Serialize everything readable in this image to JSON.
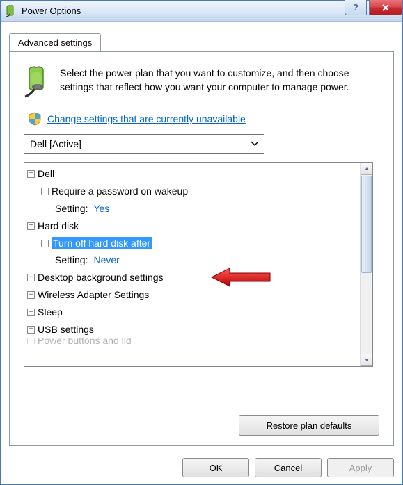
{
  "window": {
    "title": "Power Options"
  },
  "tabs": {
    "advanced": "Advanced settings"
  },
  "intro": {
    "text": "Select the power plan that you want to customize, and then choose settings that reflect how you want your computer to manage power."
  },
  "shield": {
    "link_text": "Change settings that are currently unavailable"
  },
  "combo": {
    "selected": "Dell [Active]"
  },
  "tree": {
    "root": "Dell",
    "password": {
      "label": "Require a password on wakeup",
      "setting_label": "Setting:",
      "setting_value": "Yes"
    },
    "harddisk": {
      "label": "Hard disk",
      "turnoff": {
        "label": "Turn off hard disk after",
        "setting_label": "Setting:",
        "setting_value": "Never"
      }
    },
    "desktop_bg": "Desktop background settings",
    "wireless": "Wireless Adapter Settings",
    "sleep": "Sleep",
    "usb": "USB settings",
    "power_buttons": "Power buttons and lid"
  },
  "buttons": {
    "restore": "Restore plan defaults",
    "ok": "OK",
    "cancel": "Cancel",
    "apply": "Apply"
  },
  "expander": {
    "plus": "+",
    "minus": "−"
  }
}
